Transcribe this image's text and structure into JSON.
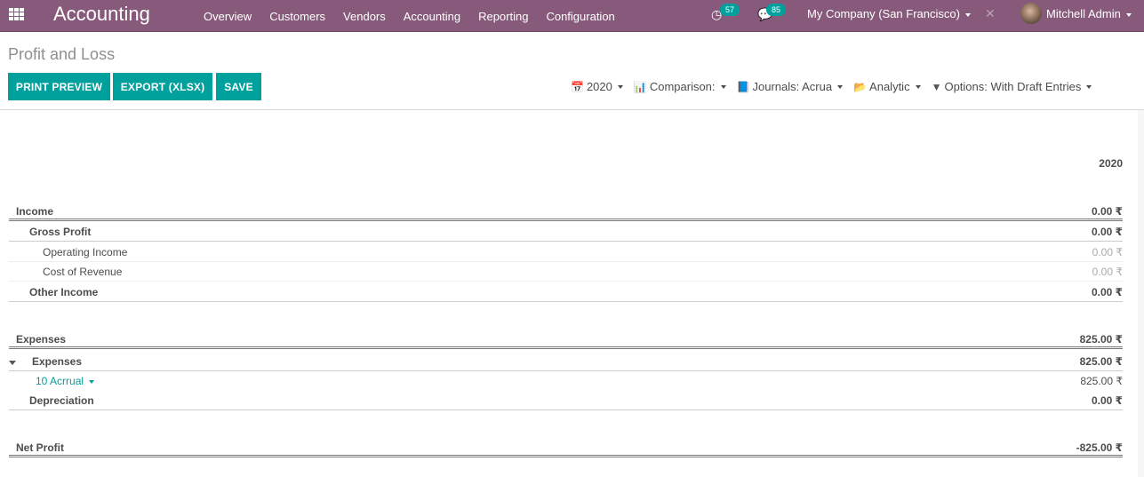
{
  "navbar": {
    "app_title": "Accounting",
    "menu": [
      "Overview",
      "Customers",
      "Vendors",
      "Accounting",
      "Reporting",
      "Configuration"
    ],
    "activity_count": "57",
    "message_count": "85",
    "company": "My Company (San Francisco)",
    "user": "Mitchell Admin",
    "brand_color": "#875a7b"
  },
  "control_panel": {
    "title": "Profit and Loss",
    "buttons": {
      "print": "PRINT PREVIEW",
      "export": "EXPORT (XLSX)",
      "save": "SAVE"
    },
    "filters": {
      "date": "2020",
      "comparison": "Comparison:",
      "journals": "Journals: Acrua",
      "analytic": "Analytic",
      "options": "Options: With Draft Entries"
    },
    "accent_color": "#00a09d"
  },
  "report": {
    "column_header": "2020",
    "rows": [
      {
        "label": "Income",
        "value": "0.00 ₹"
      },
      {
        "label": "Gross Profit",
        "value": "0.00 ₹"
      },
      {
        "label": "Operating Income",
        "value": "0.00 ₹"
      },
      {
        "label": "Cost of Revenue",
        "value": "0.00 ₹"
      },
      {
        "label": "Other Income",
        "value": "0.00 ₹"
      },
      {
        "label": "Expenses",
        "value": "825.00 ₹"
      },
      {
        "label": "Expenses",
        "value": "825.00 ₹"
      },
      {
        "label": "10 Acrrual",
        "value": "825.00 ₹"
      },
      {
        "label": "Depreciation",
        "value": "0.00 ₹"
      },
      {
        "label": "Net Profit",
        "value": "-825.00 ₹"
      }
    ]
  }
}
